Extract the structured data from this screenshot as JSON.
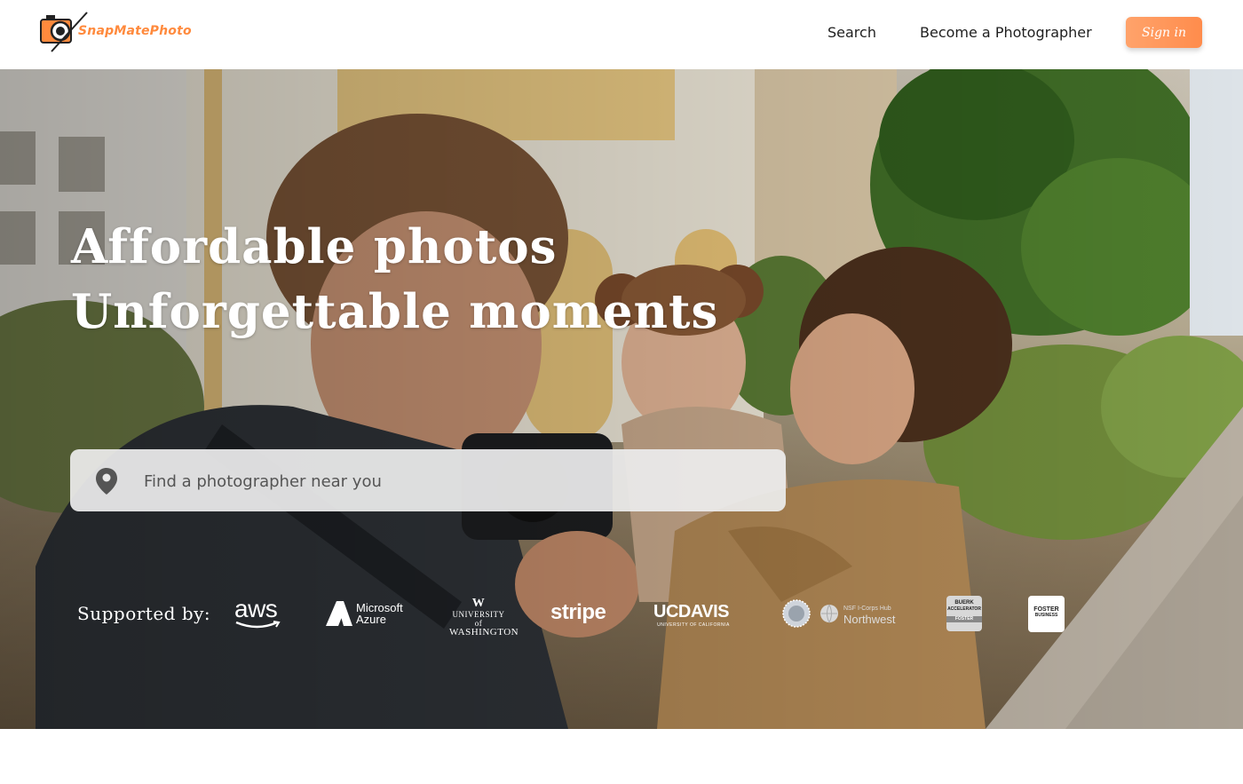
{
  "brand": {
    "name": "SnapMatePhoto",
    "accent_color": "#ff8a3d",
    "logo_icon": "camera-icon"
  },
  "nav": {
    "search_label": "Search",
    "become_label": "Become a Photographer",
    "signin_label": "Sign in"
  },
  "hero": {
    "headline_line1": "Affordable photos",
    "headline_line2": "Unforgettable moments",
    "search": {
      "placeholder": "Find a photographer near you",
      "icon": "location-pin-icon"
    },
    "supported_label": "Supported by:",
    "sponsors": [
      {
        "name": "aws"
      },
      {
        "name": "Microsoft Azure",
        "line1": "Microsoft",
        "line2": "Azure"
      },
      {
        "name": "University of Washington",
        "line1": "W",
        "line2": "UNIVERSITY of",
        "line3": "WASHINGTON"
      },
      {
        "name": "stripe"
      },
      {
        "name": "UC DAVIS",
        "line1": "UCDAVIS",
        "line2": "UNIVERSITY OF CALIFORNIA"
      },
      {
        "name": "NSF I-Corps Northwest",
        "line1": "NSF I-Corps Hub",
        "line2": "Northwest"
      },
      {
        "name": "Buerk Accelerator",
        "line1": "BUERK",
        "line2": "ACCELERATOR",
        "line3": "FOSTER"
      },
      {
        "name": "Foster School of Business",
        "line1": "FOSTER",
        "line2": "BUSINESS"
      }
    ]
  }
}
